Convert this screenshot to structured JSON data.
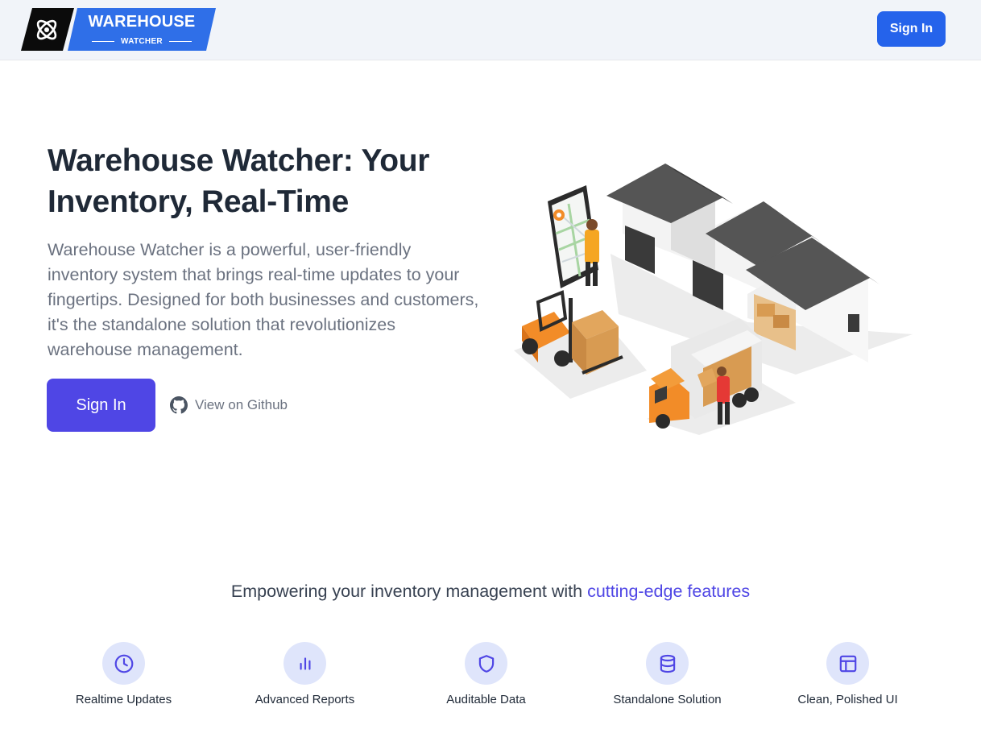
{
  "header": {
    "logo_title": "WAREHOUSE",
    "logo_subtitle": "WATCHER",
    "signin_label": "Sign In"
  },
  "hero": {
    "title": "Warehouse Watcher: Your Inventory, Real-Time",
    "description": "Warehouse Watcher is a powerful, user-friendly inventory system that brings real-time updates to your fingertips. Designed for both businesses and customers, it's the standalone solution that revolutionizes warehouse management.",
    "signin_label": "Sign In",
    "github_label": "View on Github"
  },
  "features": {
    "heading_prefix": "Empowering your inventory management with ",
    "heading_accent": "cutting-edge features",
    "items": [
      {
        "label": "Realtime Updates",
        "icon": "clock-icon"
      },
      {
        "label": "Advanced Reports",
        "icon": "bar-chart-icon"
      },
      {
        "label": "Auditable Data",
        "icon": "shield-icon"
      },
      {
        "label": "Standalone Solution",
        "icon": "database-icon"
      },
      {
        "label": "Clean, Polished UI",
        "icon": "layout-icon"
      }
    ]
  },
  "colors": {
    "primary_blue": "#2563eb",
    "indigo": "#4f46e5",
    "logo_blue": "#2f6fe8",
    "header_bg": "#f1f4f9",
    "icon_circle": "#dfe5fb"
  }
}
